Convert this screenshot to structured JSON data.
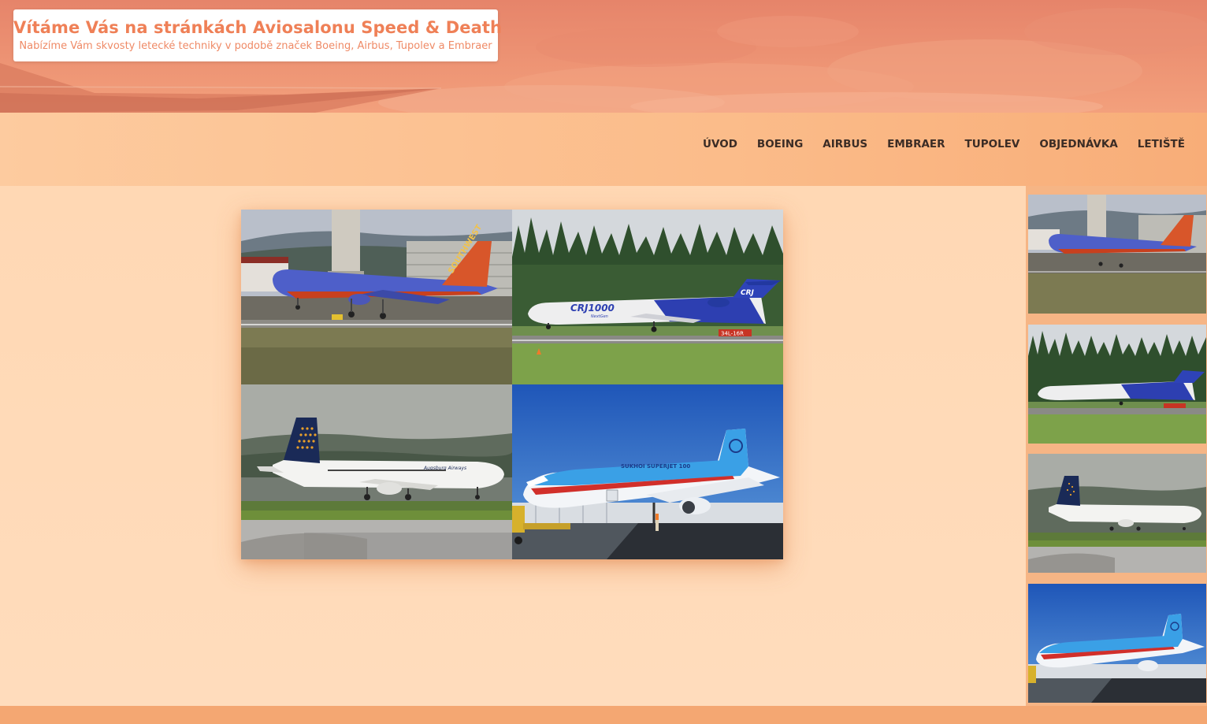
{
  "header": {
    "title": "Vítáme Vás na stránkách Aviosalonu Speed & Death",
    "subtitle": "Nabízíme Vám skvosty letecké techniky v podobě značek Boeing, Airbus, Tupolev a Embraer"
  },
  "nav": {
    "items": [
      "Úvod",
      "Boeing",
      "Airbus",
      "Embraer",
      "Tupolev",
      "Objednávka",
      "Letiště"
    ]
  },
  "photos": {
    "southwest_livery": "SOUTHWEST",
    "crj_livery": "CRJ1000",
    "crj_sub": "NextGen",
    "crj_tail": "CRJ",
    "runway_sign": "34L-16R",
    "augsburg_livery": "Augsburg Airways",
    "sukhoi_livery": "SUKHOI SUPERJET 100"
  },
  "colors": {
    "banner": "#ec8f6f",
    "title": "#ef8057",
    "nav_bg": "#fbbc8a",
    "nav_text": "#3b2c25",
    "main_bg": "#ffd8b4",
    "sidebar_bg": "#f6b585",
    "footer_bg": "#f4a772"
  }
}
